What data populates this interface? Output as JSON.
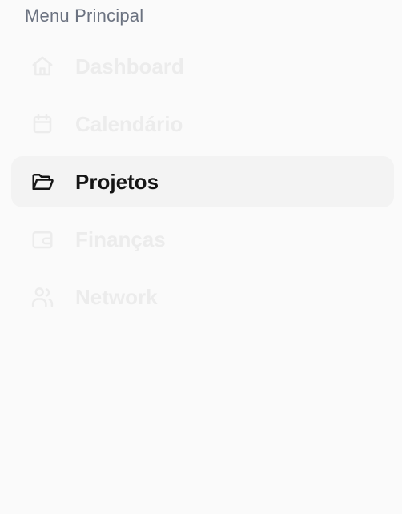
{
  "menu": {
    "title": "Menu Principal",
    "items": [
      {
        "label": "Dashboard",
        "icon": "home-icon",
        "state": "faded"
      },
      {
        "label": "Calendário",
        "icon": "calendar-icon",
        "state": "faded"
      },
      {
        "label": "Projetos",
        "icon": "folder-open-icon",
        "state": "active"
      },
      {
        "label": "Finanças",
        "icon": "wallet-icon",
        "state": "faded"
      },
      {
        "label": "Network",
        "icon": "users-icon",
        "state": "faded"
      }
    ]
  },
  "colors": {
    "background": "#fafafa",
    "active_bg": "#f3f3f3",
    "active_text": "#151515",
    "faded_text": "#ececec",
    "section_title": "#6b7280"
  }
}
